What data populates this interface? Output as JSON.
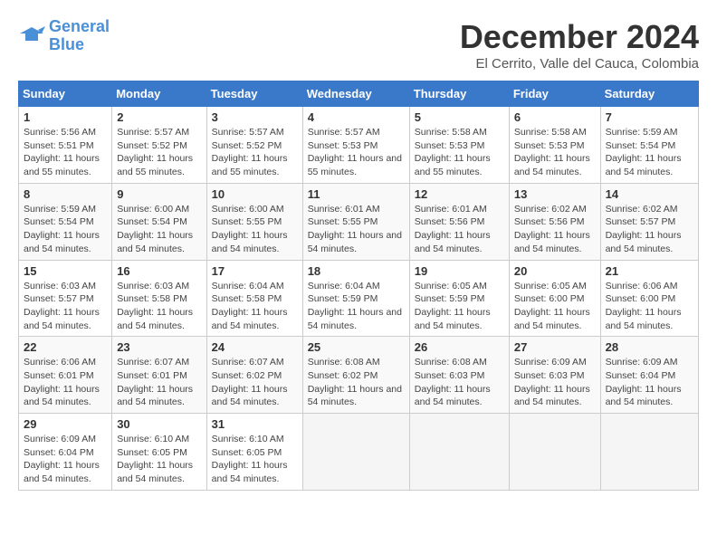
{
  "logo": {
    "line1": "General",
    "line2": "Blue"
  },
  "title": "December 2024",
  "subtitle": "El Cerrito, Valle del Cauca, Colombia",
  "days_of_week": [
    "Sunday",
    "Monday",
    "Tuesday",
    "Wednesday",
    "Thursday",
    "Friday",
    "Saturday"
  ],
  "weeks": [
    [
      {
        "day": 1,
        "sunrise": "5:56 AM",
        "sunset": "5:51 PM",
        "daylight": "11 hours and 55 minutes."
      },
      {
        "day": 2,
        "sunrise": "5:57 AM",
        "sunset": "5:52 PM",
        "daylight": "11 hours and 55 minutes."
      },
      {
        "day": 3,
        "sunrise": "5:57 AM",
        "sunset": "5:52 PM",
        "daylight": "11 hours and 55 minutes."
      },
      {
        "day": 4,
        "sunrise": "5:57 AM",
        "sunset": "5:53 PM",
        "daylight": "11 hours and 55 minutes."
      },
      {
        "day": 5,
        "sunrise": "5:58 AM",
        "sunset": "5:53 PM",
        "daylight": "11 hours and 55 minutes."
      },
      {
        "day": 6,
        "sunrise": "5:58 AM",
        "sunset": "5:53 PM",
        "daylight": "11 hours and 54 minutes."
      },
      {
        "day": 7,
        "sunrise": "5:59 AM",
        "sunset": "5:54 PM",
        "daylight": "11 hours and 54 minutes."
      }
    ],
    [
      {
        "day": 8,
        "sunrise": "5:59 AM",
        "sunset": "5:54 PM",
        "daylight": "11 hours and 54 minutes."
      },
      {
        "day": 9,
        "sunrise": "6:00 AM",
        "sunset": "5:54 PM",
        "daylight": "11 hours and 54 minutes."
      },
      {
        "day": 10,
        "sunrise": "6:00 AM",
        "sunset": "5:55 PM",
        "daylight": "11 hours and 54 minutes."
      },
      {
        "day": 11,
        "sunrise": "6:01 AM",
        "sunset": "5:55 PM",
        "daylight": "11 hours and 54 minutes."
      },
      {
        "day": 12,
        "sunrise": "6:01 AM",
        "sunset": "5:56 PM",
        "daylight": "11 hours and 54 minutes."
      },
      {
        "day": 13,
        "sunrise": "6:02 AM",
        "sunset": "5:56 PM",
        "daylight": "11 hours and 54 minutes."
      },
      {
        "day": 14,
        "sunrise": "6:02 AM",
        "sunset": "5:57 PM",
        "daylight": "11 hours and 54 minutes."
      }
    ],
    [
      {
        "day": 15,
        "sunrise": "6:03 AM",
        "sunset": "5:57 PM",
        "daylight": "11 hours and 54 minutes."
      },
      {
        "day": 16,
        "sunrise": "6:03 AM",
        "sunset": "5:58 PM",
        "daylight": "11 hours and 54 minutes."
      },
      {
        "day": 17,
        "sunrise": "6:04 AM",
        "sunset": "5:58 PM",
        "daylight": "11 hours and 54 minutes."
      },
      {
        "day": 18,
        "sunrise": "6:04 AM",
        "sunset": "5:59 PM",
        "daylight": "11 hours and 54 minutes."
      },
      {
        "day": 19,
        "sunrise": "6:05 AM",
        "sunset": "5:59 PM",
        "daylight": "11 hours and 54 minutes."
      },
      {
        "day": 20,
        "sunrise": "6:05 AM",
        "sunset": "6:00 PM",
        "daylight": "11 hours and 54 minutes."
      },
      {
        "day": 21,
        "sunrise": "6:06 AM",
        "sunset": "6:00 PM",
        "daylight": "11 hours and 54 minutes."
      }
    ],
    [
      {
        "day": 22,
        "sunrise": "6:06 AM",
        "sunset": "6:01 PM",
        "daylight": "11 hours and 54 minutes."
      },
      {
        "day": 23,
        "sunrise": "6:07 AM",
        "sunset": "6:01 PM",
        "daylight": "11 hours and 54 minutes."
      },
      {
        "day": 24,
        "sunrise": "6:07 AM",
        "sunset": "6:02 PM",
        "daylight": "11 hours and 54 minutes."
      },
      {
        "day": 25,
        "sunrise": "6:08 AM",
        "sunset": "6:02 PM",
        "daylight": "11 hours and 54 minutes."
      },
      {
        "day": 26,
        "sunrise": "6:08 AM",
        "sunset": "6:03 PM",
        "daylight": "11 hours and 54 minutes."
      },
      {
        "day": 27,
        "sunrise": "6:09 AM",
        "sunset": "6:03 PM",
        "daylight": "11 hours and 54 minutes."
      },
      {
        "day": 28,
        "sunrise": "6:09 AM",
        "sunset": "6:04 PM",
        "daylight": "11 hours and 54 minutes."
      }
    ],
    [
      {
        "day": 29,
        "sunrise": "6:09 AM",
        "sunset": "6:04 PM",
        "daylight": "11 hours and 54 minutes."
      },
      {
        "day": 30,
        "sunrise": "6:10 AM",
        "sunset": "6:05 PM",
        "daylight": "11 hours and 54 minutes."
      },
      {
        "day": 31,
        "sunrise": "6:10 AM",
        "sunset": "6:05 PM",
        "daylight": "11 hours and 54 minutes."
      },
      null,
      null,
      null,
      null
    ]
  ]
}
